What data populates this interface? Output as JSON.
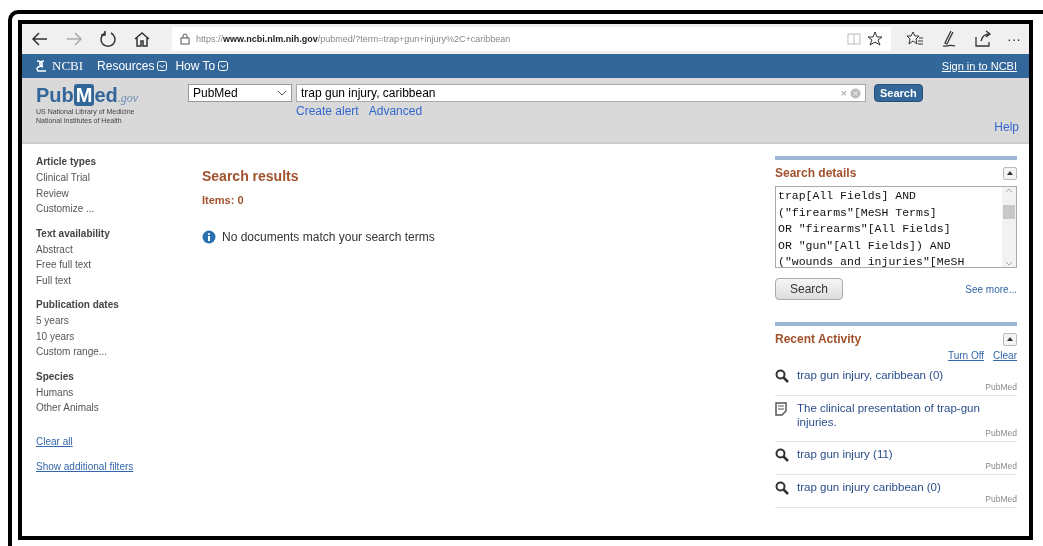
{
  "browser": {
    "url_prefix": "https://",
    "url_host": "www.ncbi.nlm.nih.gov",
    "url_path": "/pubmed/?term=trap+gun+injury%2C+caribbean",
    "more": "···"
  },
  "ncbi_bar": {
    "logo": "NCBI",
    "menus": [
      "Resources",
      "How To"
    ],
    "sign_in": "Sign in to NCBI"
  },
  "header": {
    "logo_pub": "Pub",
    "logo_m": "M",
    "logo_ed": "ed",
    "logo_gov": ".gov",
    "subtitle_1": "US National Library of Medicine",
    "subtitle_2": "National Institutes of Health",
    "database": "PubMed",
    "query": "trap gun injury, caribbean",
    "clear": "×",
    "search": "Search",
    "links": [
      "Create alert",
      "Advanced"
    ],
    "help": "Help"
  },
  "filters": [
    {
      "title": "Article types",
      "items": [
        "Clinical Trial",
        "Review",
        "Customize ..."
      ]
    },
    {
      "title": "Text availability",
      "items": [
        "Abstract",
        "Free full text",
        "Full text"
      ]
    },
    {
      "title": "Publication dates",
      "items": [
        "5 years",
        "10 years",
        "Custom range..."
      ]
    },
    {
      "title": "Species",
      "items": [
        "Humans",
        "Other Animals"
      ]
    }
  ],
  "filter_links": [
    "Clear all",
    "Show additional filters"
  ],
  "results": {
    "title": "Search results",
    "items": "Items: 0",
    "message": "No documents match your search terms"
  },
  "search_details": {
    "title": "Search details",
    "lines": [
      "trap[All Fields] AND",
      "(\"firearms\"[MeSH Terms]",
      "OR \"firearms\"[All Fields]",
      "OR \"gun\"[All Fields]) AND",
      "(\"wounds and injuries\"[MeSH"
    ],
    "button": "Search",
    "see_more": "See more..."
  },
  "recent_activity": {
    "title": "Recent Activity",
    "actions": [
      "Turn Off",
      "Clear"
    ],
    "items": [
      {
        "kind": "search",
        "text": "trap gun injury, caribbean (0)",
        "source": "PubMed"
      },
      {
        "kind": "document",
        "text": "The clinical presentation of trap-gun injuries.",
        "source": "PubMed"
      },
      {
        "kind": "search",
        "text": "trap gun injury (11)",
        "source": "PubMed"
      },
      {
        "kind": "search",
        "text": "trap gun injury caribbean (0)",
        "source": "PubMed"
      }
    ]
  }
}
